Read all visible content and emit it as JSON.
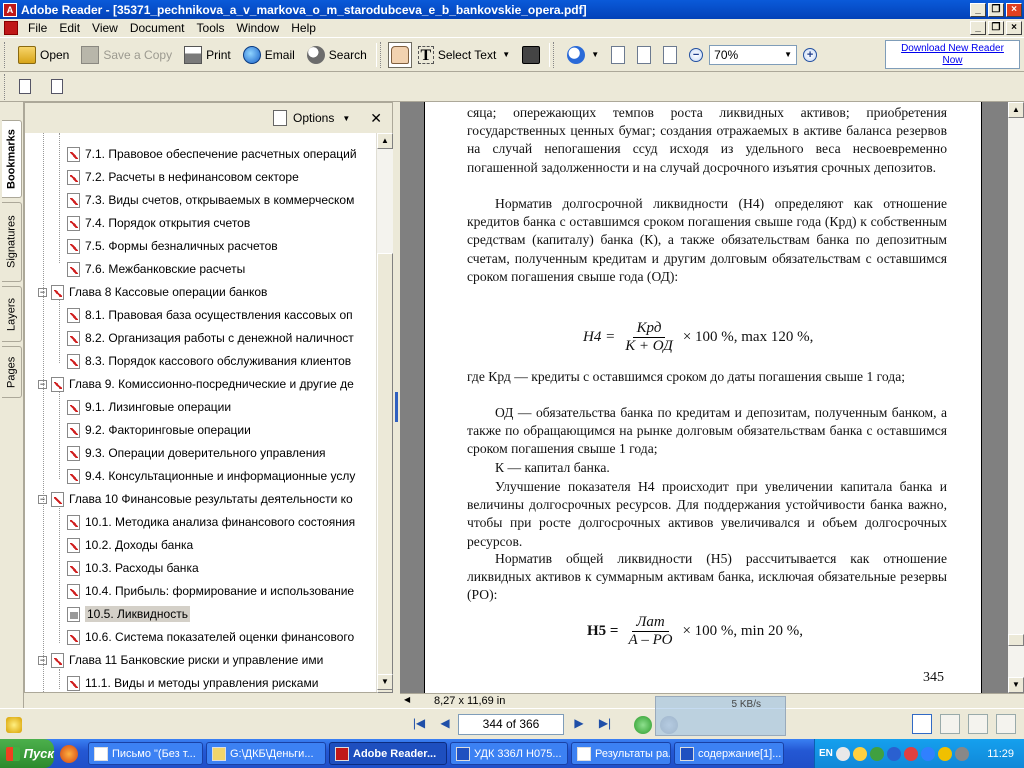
{
  "window": {
    "title": "Adobe Reader - [35371_pechnikova_a_v_markova_o_m_starodubceva_e_b_bankovskie_opera.pdf]"
  },
  "menu": [
    "File",
    "Edit",
    "View",
    "Document",
    "Tools",
    "Window",
    "Help"
  ],
  "toolbar": {
    "open": "Open",
    "save_copy": "Save a Copy",
    "print": "Print",
    "email": "Email",
    "search": "Search",
    "select_text": "Select Text",
    "zoom": "70%",
    "download_line1": "Download New Reader",
    "download_line2": "Now"
  },
  "side_tabs": [
    "Bookmarks",
    "Signatures",
    "Layers",
    "Pages"
  ],
  "bookmarks": {
    "options_label": "Options",
    "items": [
      "7.1. Правовое обеспечение расчетных операций",
      "7.2. Расчеты в нефинансовом секторе",
      "7.3. Виды счетов, открываемых в коммерческом",
      "7.4. Порядок открытия счетов",
      "7.5. Формы безналичных расчетов",
      "7.6. Межбанковские расчеты",
      "Глава 8 Кассовые операции банков",
      "8.1. Правовая база осуществления кассовых оп",
      "8.2. Организация работы с денежной наличност",
      "8.3. Порядок кассового обслуживания клиентов",
      "Глава 9. Комиссионно-посреднические и другие де",
      "9.1. Лизинговые операции",
      "9.2. Факторинговые операции",
      "9.3. Операции доверительного управления",
      "9.4. Консультационные и информационные услу",
      "Глава 10 Финансовые результаты деятельности ко",
      "10.1. Методика анализа финансового состояния",
      "10.2. Доходы банка",
      "10.3. Расходы банка",
      "10.4. Прибыль: формирование и использование",
      "10.5. Ликвидность",
      "10.6. Система показателей оценки финансового",
      "Глава 11 Банковские риски и управление ими",
      "11.1. Виды и методы управления рисками"
    ]
  },
  "document": {
    "para1": "сяца; опережающих темпов роста ликвидных активов; приобретения государственных ценных бумаг; создания отражаемых в активе баланса резервов на случай непогашения ссуд исходя из удельного веса несвоевременно погашенной задолженности и на случай досрочного изъятия срочных депозитов.",
    "para2": "Норматив долгосрочной ликвидности (Н4) определяют как отношение кредитов банка с оставшимся сроком погашения свыше года (Крд) к собственным средствам (капиталу) банка (К), а также обязательствам банка по депозитным счетам, полученным кредитам и другим долговым обязательствам с оставшимся сроком погашения свыше года (ОД):",
    "f1_lhs": "Н4 =",
    "f1_num": "Крд",
    "f1_den": "К + ОД",
    "f1_rhs": "× 100 %, max 120 %,",
    "para3": "где Крд — кредиты с оставшимся сроком до даты погашения свыше 1 года;",
    "para4": "ОД — обязательства банка по кредитам и депозитам, полученным банком, а также по обращающимся на рынке долговым обязательствам банка с оставшимся сроком погашения свыше 1 года;",
    "para5": "К — капитал банка.",
    "para6": "Улучшение показателя Н4 происходит при увеличении капитала банка и величины долгосрочных ресурсов. Для поддержания устойчивости банка важно, чтобы при росте долгосрочных активов увеличивался и объем долгосрочных ресурсов.",
    "para7": "Норматив общей ликвидности (Н5) рассчитывается как отношение ликвидных активов к суммарным активам банка, исключая обязательные резервы (РО):",
    "f2_lhs": "Н5 =",
    "f2_num": "Лат",
    "f2_den": "А – РО",
    "f2_rhs": "× 100 %, min 20 %,",
    "page_number": "345"
  },
  "statusbar": {
    "page_size": "8,27 x 11,69 in",
    "page_indicator": "344 of 366",
    "speed": "5 KB/s"
  },
  "taskbar": {
    "start": "Пуск",
    "items": [
      "Письмо \"(Без т...",
      "G:\\ДКБ\\Деньги...",
      "Adobe Reader...",
      "УДК 336Л Н075...",
      "Результаты ра...",
      "содержание[1]..."
    ],
    "lang": "EN",
    "clock": "11:29"
  }
}
